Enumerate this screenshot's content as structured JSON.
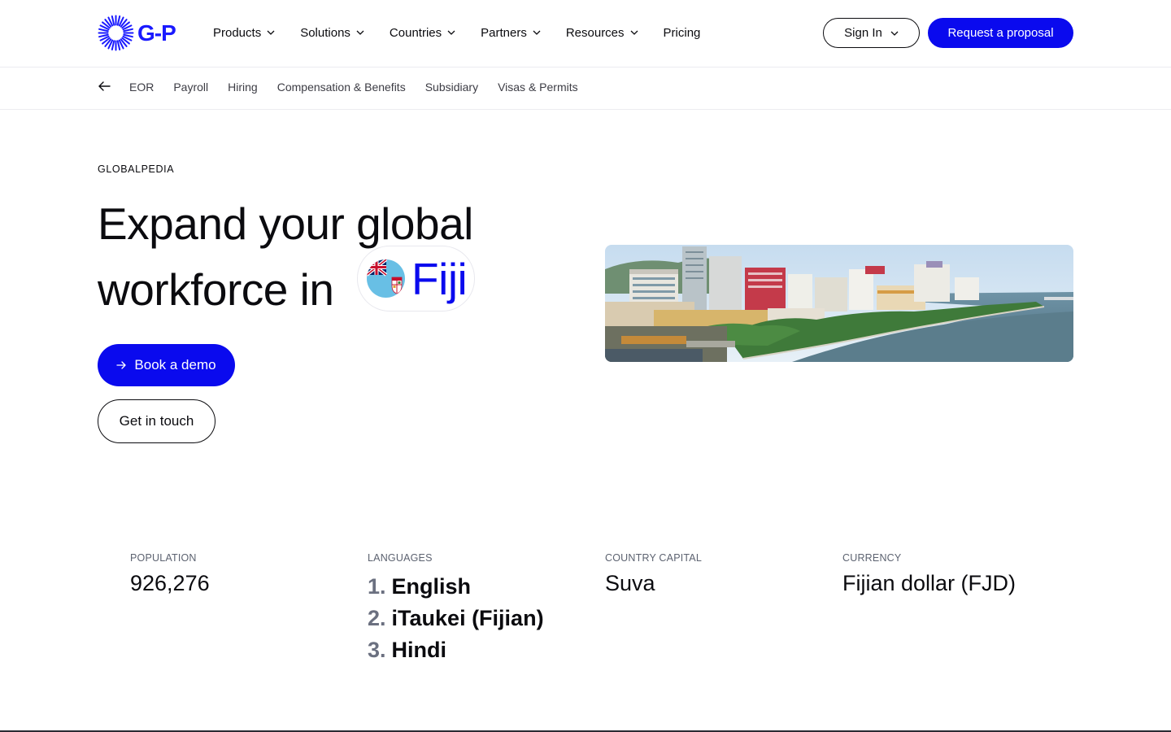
{
  "brand": {
    "logo_text": "G-P",
    "accent": "#0a0aee"
  },
  "nav": {
    "items": [
      {
        "label": "Products",
        "dropdown": true
      },
      {
        "label": "Solutions",
        "dropdown": true
      },
      {
        "label": "Countries",
        "dropdown": true
      },
      {
        "label": "Partners",
        "dropdown": true
      },
      {
        "label": "Resources",
        "dropdown": true
      },
      {
        "label": "Pricing",
        "dropdown": false
      }
    ],
    "sign_in": "Sign In",
    "request": "Request a proposal"
  },
  "subnav": {
    "items": [
      "EOR",
      "Payroll",
      "Hiring",
      "Compensation & Benefits",
      "Subsidiary",
      "Visas & Permits"
    ]
  },
  "hero": {
    "eyebrow": "GLOBALPEDIA",
    "line1": "Expand your global",
    "line2": "workforce in",
    "country": "Fiji",
    "book_demo": "Book a demo",
    "get_in_touch": "Get in touch"
  },
  "facts": {
    "population": {
      "label": "POPULATION",
      "value": "926,276"
    },
    "languages": {
      "label": "LANGUAGES",
      "items": [
        {
          "num": "1.",
          "name": "English"
        },
        {
          "num": "2.",
          "name": "iTaukei (Fijian)"
        },
        {
          "num": "3.",
          "name": "Hindi"
        }
      ]
    },
    "capital": {
      "label": "COUNTRY CAPITAL",
      "value": "Suva"
    },
    "currency": {
      "label": "CURRENCY",
      "value": "Fijian dollar (FJD)"
    }
  }
}
